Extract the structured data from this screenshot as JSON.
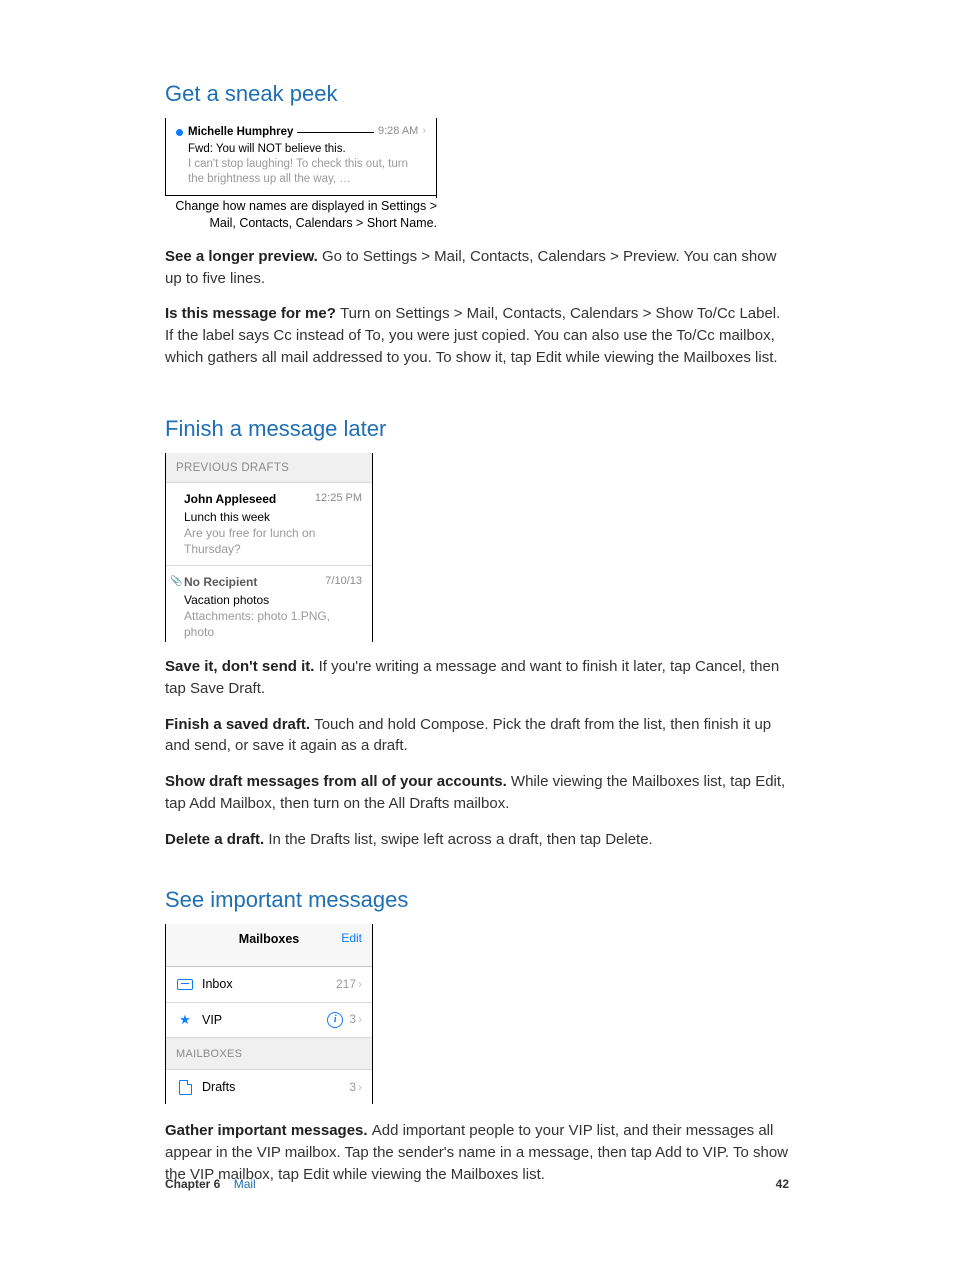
{
  "section1": {
    "heading": "Get a sneak peek",
    "fig": {
      "sender": "Michelle Humphrey",
      "time": "9:28 AM",
      "subject": "Fwd: You will NOT believe this.",
      "preview": "I can't stop laughing! To check this out, turn the brightness up all the way, …"
    },
    "callout": "Change how names are displayed in Settings > Mail, Contacts, Calendars > Short Name.",
    "para1_lead": "See a longer preview. ",
    "para1_body": "Go to Settings > Mail, Contacts, Calendars > Preview. You can show up to five lines.",
    "para2_lead": "Is this message for me? ",
    "para2_body": "Turn on Settings > Mail, Contacts, Calendars > Show To/Cc Label. If the label says Cc instead of To, you were just copied. You can also use the To/Cc mailbox, which gathers all mail addressed to you. To show it, tap Edit while viewing the Mailboxes list."
  },
  "section2": {
    "heading": "Finish a message later",
    "drafts_header": "PREVIOUS DRAFTS",
    "draft1": {
      "name": "John Appleseed",
      "time": "12:25 PM",
      "subject": "Lunch this week",
      "preview": "Are you free for lunch on Thursday?"
    },
    "draft2": {
      "name": "No Recipient",
      "time": "7/10/13",
      "subject": "Vacation photos",
      "preview": "Attachments: photo 1.PNG, photo"
    },
    "para1_lead": "Save it, don't send it. ",
    "para1_body": "If you're writing a message and want to finish it later, tap Cancel, then tap Save Draft.",
    "para2_lead": "Finish a saved draft. ",
    "para2_body": "Touch and hold Compose. Pick the draft from the list, then finish it up and send, or save it again as a draft.",
    "para3_lead": "Show draft messages from all of your accounts.  ",
    "para3_body": "While viewing the Mailboxes list, tap Edit, tap Add Mailbox, then turn on the All Drafts mailbox.",
    "para4_lead": "Delete a draft. ",
    "para4_body": "In the Drafts list, swipe left across a draft, then tap Delete."
  },
  "section3": {
    "heading": "See important messages",
    "mailboxes": {
      "title": "Mailboxes",
      "edit": "Edit",
      "inbox_label": "Inbox",
      "inbox_count": "217",
      "vip_label": "VIP",
      "vip_count": "3",
      "section_label": "MAILBOXES",
      "drafts_label": "Drafts",
      "drafts_count": "3"
    },
    "para1_lead": "Gather important messages. ",
    "para1_body": "Add important people to your VIP list, and their messages all appear in the VIP mailbox. Tap the sender's name in a message, then tap Add to VIP. To show the VIP mailbox, tap Edit while viewing the Mailboxes list."
  },
  "footer": {
    "chapter": "Chapter  6",
    "title": "Mail",
    "page": "42"
  }
}
